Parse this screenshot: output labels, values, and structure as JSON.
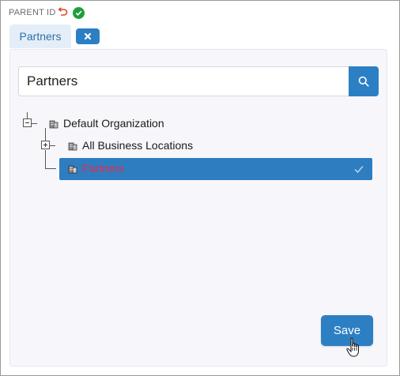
{
  "field": {
    "label": "PARENT ID",
    "revert_icon": "undo-icon",
    "status_icon": "check-circle-icon",
    "status_color": "#1e9e3a",
    "revert_color": "#e04a2a"
  },
  "selected_chip": {
    "label": "Partners",
    "clear_icon": "close-icon"
  },
  "search": {
    "value": "Partners",
    "icon": "search-icon"
  },
  "tree": {
    "root": {
      "label": "Default Organization",
      "expanded": true,
      "icon": "building-icon"
    },
    "children": [
      {
        "label": "All Business Locations",
        "expanded": false,
        "icon": "building-icon"
      },
      {
        "label": "Partners",
        "selected": true,
        "icon": "building-icon",
        "check_icon": "check-icon"
      }
    ]
  },
  "actions": {
    "save_label": "Save"
  },
  "colors": {
    "accent": "#2d7fc4",
    "selected_row": "#2f7dc1",
    "selected_text": "#e8294a",
    "chip_bg": "#e4eef8",
    "chip_text": "#2e6fa8",
    "panel_bg": "#f7f7fb"
  }
}
